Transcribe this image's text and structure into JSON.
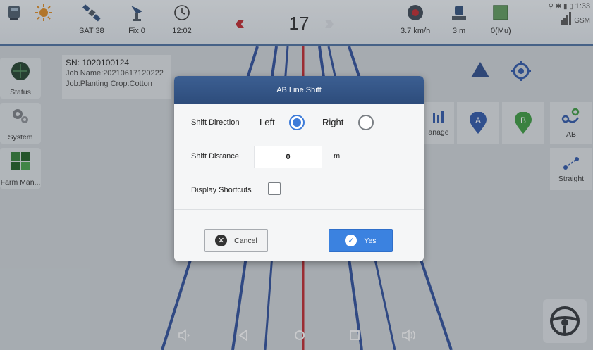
{
  "topbar": {
    "sat_label": "SAT 38",
    "fix_label": "Fix 0",
    "clock_label": "12:02",
    "heading_arrows_left": "‹‹‹",
    "heading_arrows_right": "›››",
    "heading_value": "17",
    "speed_label": "3.7 km/h",
    "distance_label": "3 m",
    "area_label": "0(Mu)",
    "status_time": "1:33",
    "network_label": "GSM"
  },
  "sidebar": {
    "items": [
      {
        "label": "Status"
      },
      {
        "label": "System"
      },
      {
        "label": "Farm Man..."
      }
    ]
  },
  "info": {
    "sn": "SN: 1020100124",
    "job_name": "Job Name:20210617120222",
    "job_detail": "Job:Planting  Crop:Cotton"
  },
  "right_panel": {
    "manage_label": "anage",
    "point_a": "A",
    "point_b": "B",
    "ab_label": "AB",
    "straight_label": "Straight"
  },
  "dialog": {
    "title": "AB Line Shift",
    "direction_label": "Shift Direction",
    "left_option": "Left",
    "right_option": "Right",
    "selected_direction": "Left",
    "distance_label": "Shift Distance",
    "distance_value": "0",
    "distance_unit": "m",
    "shortcuts_label": "Display Shortcuts",
    "shortcuts_checked": false,
    "cancel_label": "Cancel",
    "yes_label": "Yes"
  },
  "colors": {
    "accent": "#3b82e0",
    "title_bar": "#2d4c7b",
    "guidance_line": "#c0262b"
  }
}
